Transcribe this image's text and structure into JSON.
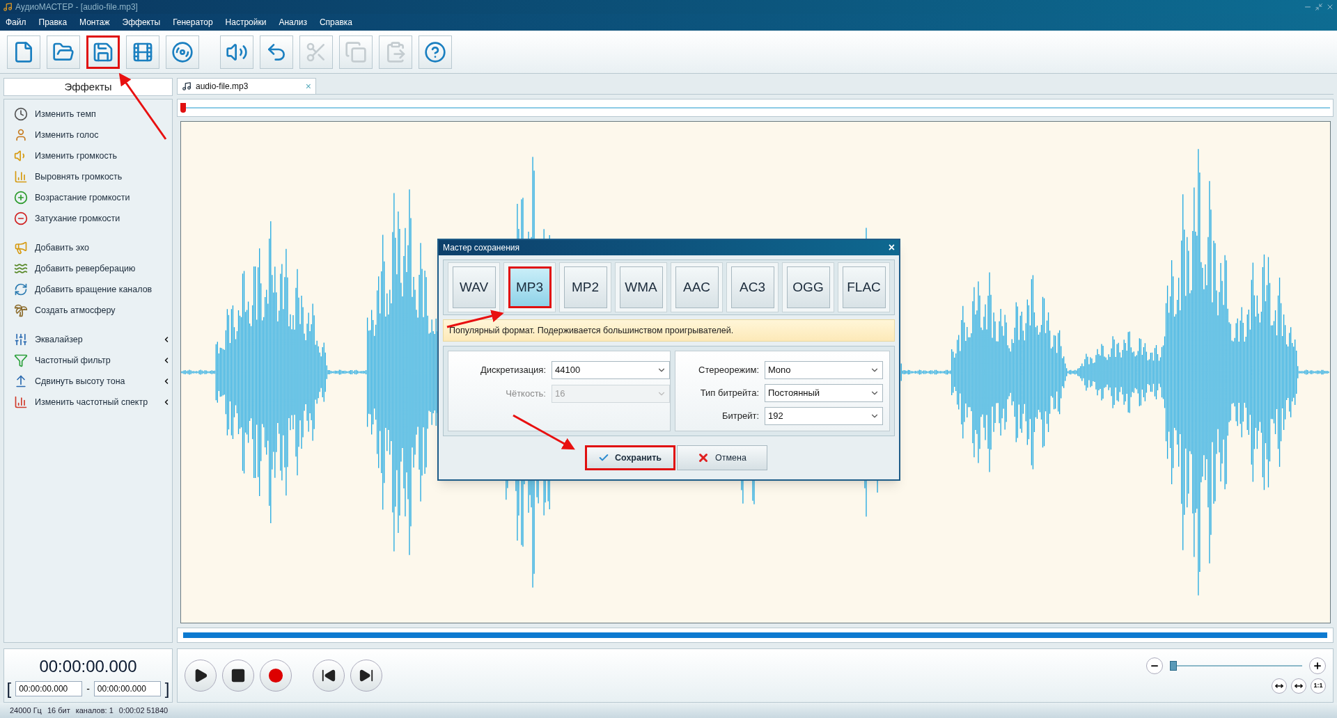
{
  "window": {
    "title": "АудиоМАСТЕР - [audio-file.mp3]"
  },
  "menu": [
    "Файл",
    "Правка",
    "Монтаж",
    "Эффекты",
    "Генератор",
    "Настройки",
    "Анализ",
    "Справка"
  ],
  "toolbar": [
    {
      "disabled": false,
      "highlighted": false
    },
    {
      "disabled": false,
      "highlighted": false
    },
    {
      "disabled": false,
      "highlighted": true
    },
    {
      "disabled": false,
      "highlighted": false
    },
    {
      "disabled": false,
      "highlighted": false
    },
    {
      "disabled": false,
      "highlighted": false
    },
    {
      "disabled": false,
      "highlighted": false
    },
    {
      "disabled": true,
      "highlighted": false
    },
    {
      "disabled": true,
      "highlighted": false
    },
    {
      "disabled": true,
      "highlighted": false
    },
    {
      "disabled": false,
      "highlighted": false
    }
  ],
  "sidebar": {
    "title": "Эффекты",
    "groups": [
      {
        "items": [
          {
            "label": "Изменить темп",
            "submenu": false
          },
          {
            "label": "Изменить голос",
            "submenu": false
          },
          {
            "label": "Изменить громкость",
            "submenu": false
          },
          {
            "label": "Выровнять громкость",
            "submenu": false
          },
          {
            "label": "Возрастание громкости",
            "submenu": false
          },
          {
            "label": "Затухание громкости",
            "submenu": false
          }
        ]
      },
      {
        "items": [
          {
            "label": "Добавить эхо",
            "submenu": false
          },
          {
            "label": "Добавить реверберацию",
            "submenu": false
          },
          {
            "label": "Добавить вращение каналов",
            "submenu": false
          },
          {
            "label": "Создать атмосферу",
            "submenu": false
          }
        ]
      },
      {
        "items": [
          {
            "label": "Эквалайзер",
            "submenu": true
          },
          {
            "label": "Частотный фильтр",
            "submenu": true
          },
          {
            "label": "Сдвинуть высоту тона",
            "submenu": true
          },
          {
            "label": "Изменить частотный спектр",
            "submenu": true
          }
        ]
      }
    ]
  },
  "tab": {
    "label": "audio-file.mp3",
    "close": "×"
  },
  "dialog": {
    "title": "Мастер сохранения",
    "close": "×",
    "formats": [
      {
        "label": "WAV",
        "selected": false,
        "highlighted": false
      },
      {
        "label": "MP3",
        "selected": true,
        "highlighted": true
      },
      {
        "label": "MP2",
        "selected": false,
        "highlighted": false
      },
      {
        "label": "WMA",
        "selected": false,
        "highlighted": false
      },
      {
        "label": "AAC",
        "selected": false,
        "highlighted": false
      },
      {
        "label": "AC3",
        "selected": false,
        "highlighted": false
      },
      {
        "label": "OGG",
        "selected": false,
        "highlighted": false
      },
      {
        "label": "FLAC",
        "selected": false,
        "highlighted": false
      }
    ],
    "hint": "Популярный формат. Подерживается большинством проигрывателей.",
    "left_fields": [
      {
        "label": "Дискретизация:",
        "value": "44100",
        "disabled": false
      },
      {
        "label": "Чёткость:",
        "value": "16",
        "disabled": true
      }
    ],
    "right_fields": [
      {
        "label": "Стереорежим:",
        "value": "Mono",
        "disabled": false
      },
      {
        "label": "Тип битрейта:",
        "value": "Постоянный",
        "disabled": false
      },
      {
        "label": "Битрейт:",
        "value": "192",
        "disabled": false
      }
    ],
    "buttons": [
      {
        "label": "Сохранить",
        "kind": "save",
        "highlighted": true
      },
      {
        "label": "Отмена",
        "kind": "cancel",
        "highlighted": false
      }
    ]
  },
  "time": {
    "current": "00:00:00.000",
    "open": "[",
    "start": "00:00:00.000",
    "dash": "-",
    "end": "00:00:00.000",
    "close": "]"
  },
  "zoom": {
    "level": 0,
    "fit_label": "1:1"
  },
  "status_bar": [
    "24000 Гц",
    "16 бит",
    "каналов: 1",
    "0:00:02 51840"
  ]
}
